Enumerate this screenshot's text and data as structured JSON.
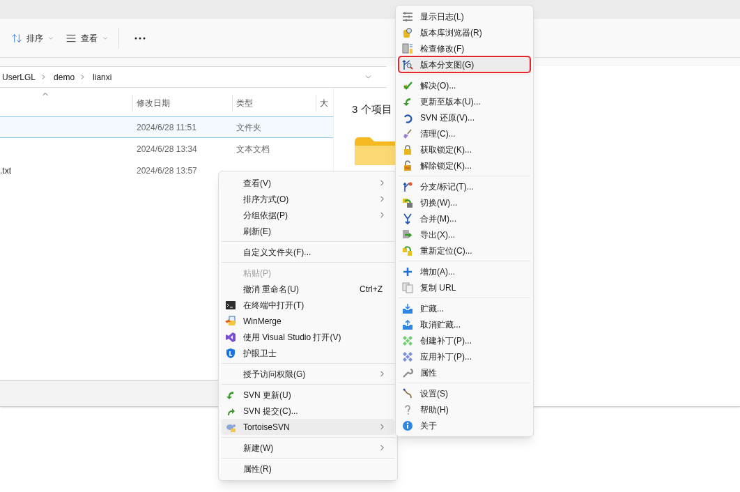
{
  "explorer": {
    "toolbar": [
      {
        "label": "排序",
        "kind": "sort"
      },
      {
        "label": "查看",
        "kind": "view"
      }
    ],
    "breadcrumb": [
      "UserLGL",
      "demo",
      "lianxi"
    ],
    "columns": [
      "修改日期",
      "类型",
      "大"
    ],
    "rows": [
      {
        "date": "2024/6/28 11:51",
        "type": "文件夹",
        "selected": true
      },
      {
        "date": "2024/6/28 13:34",
        "type": "文本文档",
        "selected": false
      },
      {
        "name": ".txt",
        "date": "2024/6/28 13:57",
        "selected": false
      }
    ],
    "preview": {
      "summary": "3 个项目"
    }
  },
  "context_menu": {
    "groups": [
      {
        "items": [
          {
            "label": "查看(V)",
            "submenu": true,
            "disabled": false,
            "selected": false
          },
          {
            "label": "排序方式(O)",
            "submenu": true,
            "disabled": false,
            "selected": false
          },
          {
            "label": "分组依据(P)",
            "submenu": true,
            "disabled": false,
            "selected": false
          },
          {
            "label": "刷新(E)",
            "submenu": false,
            "disabled": false,
            "selected": false
          }
        ]
      },
      {
        "items": [
          {
            "label": "自定义文件夹(F)...",
            "submenu": false,
            "disabled": false,
            "selected": false
          }
        ]
      },
      {
        "items": [
          {
            "label": "粘贴(P)",
            "submenu": false,
            "disabled": true,
            "selected": false
          },
          {
            "label": "撤消 重命名(U)",
            "shortcut": "Ctrl+Z",
            "submenu": false,
            "disabled": false,
            "selected": false
          },
          {
            "label": "在终端中打开(T)",
            "submenu": false,
            "disabled": false,
            "selected": false
          },
          {
            "label": "WinMerge",
            "submenu": false,
            "disabled": false,
            "selected": false
          },
          {
            "label": "使用 Visual Studio 打开(V)",
            "submenu": false,
            "disabled": false,
            "selected": false
          },
          {
            "label": "护眼卫士",
            "submenu": false,
            "disabled": false,
            "selected": false
          }
        ]
      },
      {
        "items": [
          {
            "label": "授予访问权限(G)",
            "submenu": true,
            "disabled": false,
            "selected": false
          }
        ]
      },
      {
        "items": [
          {
            "label": "SVN 更新(U)",
            "submenu": false,
            "disabled": false,
            "selected": false
          },
          {
            "label": "SVN 提交(C)...",
            "submenu": false,
            "disabled": false,
            "selected": false
          },
          {
            "label": "TortoiseSVN",
            "submenu": true,
            "disabled": false,
            "selected": true
          }
        ]
      },
      {
        "items": [
          {
            "label": "新建(W)",
            "submenu": true,
            "disabled": false,
            "selected": false
          }
        ]
      },
      {
        "items": [
          {
            "label": "属性(R)",
            "submenu": false,
            "disabled": false,
            "selected": false
          }
        ]
      }
    ]
  },
  "svn_submenu": {
    "groups": [
      {
        "items": [
          {
            "label": "显示日志(L)",
            "selected": false,
            "marked": false
          },
          {
            "label": "版本库浏览器(R)",
            "selected": false,
            "marked": false
          },
          {
            "label": "检查修改(F)",
            "selected": false,
            "marked": false
          },
          {
            "label": "版本分支图(G)",
            "selected": true,
            "marked": true
          }
        ]
      },
      {
        "items": [
          {
            "label": "解决(O)...",
            "selected": false,
            "marked": false
          },
          {
            "label": "更新至版本(U)...",
            "selected": false,
            "marked": false
          },
          {
            "label": "SVN 还原(V)...",
            "selected": false,
            "marked": false
          },
          {
            "label": "清理(C)...",
            "selected": false,
            "marked": false
          },
          {
            "label": "获取锁定(K)...",
            "selected": false,
            "marked": false
          },
          {
            "label": "解除锁定(K)...",
            "selected": false,
            "marked": false
          }
        ]
      },
      {
        "items": [
          {
            "label": "分支/标记(T)...",
            "selected": false,
            "marked": false
          },
          {
            "label": "切换(W)...",
            "selected": false,
            "marked": false
          },
          {
            "label": "合并(M)...",
            "selected": false,
            "marked": false
          },
          {
            "label": "导出(X)...",
            "selected": false,
            "marked": false
          },
          {
            "label": "重新定位(C)...",
            "selected": false,
            "marked": false
          }
        ]
      },
      {
        "items": [
          {
            "label": "增加(A)...",
            "selected": false,
            "marked": false
          },
          {
            "label": "复制 URL",
            "selected": false,
            "marked": false
          }
        ]
      },
      {
        "items": [
          {
            "label": "贮藏...",
            "selected": false,
            "marked": false
          },
          {
            "label": "取消贮藏...",
            "selected": false,
            "marked": false
          },
          {
            "label": "创建补丁(P)...",
            "selected": false,
            "marked": false
          },
          {
            "label": "应用补丁(P)...",
            "selected": false,
            "marked": false
          },
          {
            "label": "属性",
            "selected": false,
            "marked": false
          }
        ]
      },
      {
        "items": [
          {
            "label": "设置(S)",
            "selected": false,
            "marked": false
          },
          {
            "label": "帮助(H)",
            "selected": false,
            "marked": false
          },
          {
            "label": "关于",
            "selected": false,
            "marked": false
          }
        ]
      }
    ]
  }
}
